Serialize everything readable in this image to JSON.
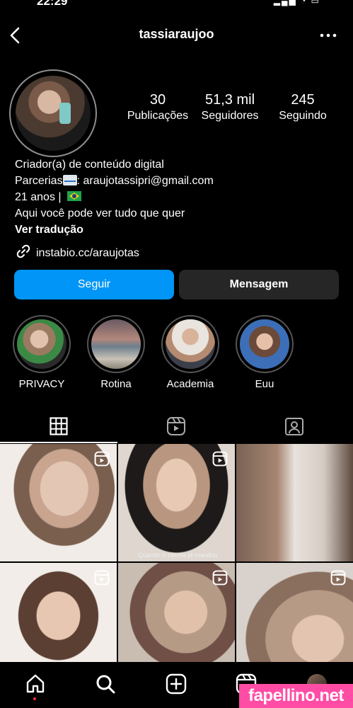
{
  "status": {
    "time": "22:29",
    "icons": "▂▄▆ ◔ ▭"
  },
  "header": {
    "username": "tassiaraujoo"
  },
  "stats": [
    {
      "value": "30",
      "label": "Publicações"
    },
    {
      "value": "51,3 mil",
      "label": "Seguidores"
    },
    {
      "value": "245",
      "label": "Seguindo"
    }
  ],
  "bio": {
    "category": "Criador(a) de conteúdo digital",
    "partnerships_prefix": "Parcerias",
    "partnerships_email": ": araujotassipri@gmail.com",
    "age": "21 anos | ",
    "description": "Aqui você pode ver tudo que quer",
    "translate": "Ver tradução",
    "link": "instabio.cc/araujotas"
  },
  "actions": {
    "follow": "Seguir",
    "message": "Mensagem"
  },
  "highlights": [
    {
      "label": "PRIVACY"
    },
    {
      "label": "Rotina"
    },
    {
      "label": "Academia"
    },
    {
      "label": "Euu"
    }
  ],
  "tabs": [
    "grid-icon",
    "reels-icon",
    "tagged-icon"
  ],
  "grid": {
    "caption": "Quando o cliente já mandou"
  },
  "nav": [
    "home-icon",
    "search-icon",
    "create-icon",
    "reels-icon",
    "profile-avatar"
  ],
  "watermark": "fapellino.net",
  "colors": {
    "accent": "#0095f6",
    "secondary_button": "#262626",
    "watermark": "#ff4da6"
  }
}
